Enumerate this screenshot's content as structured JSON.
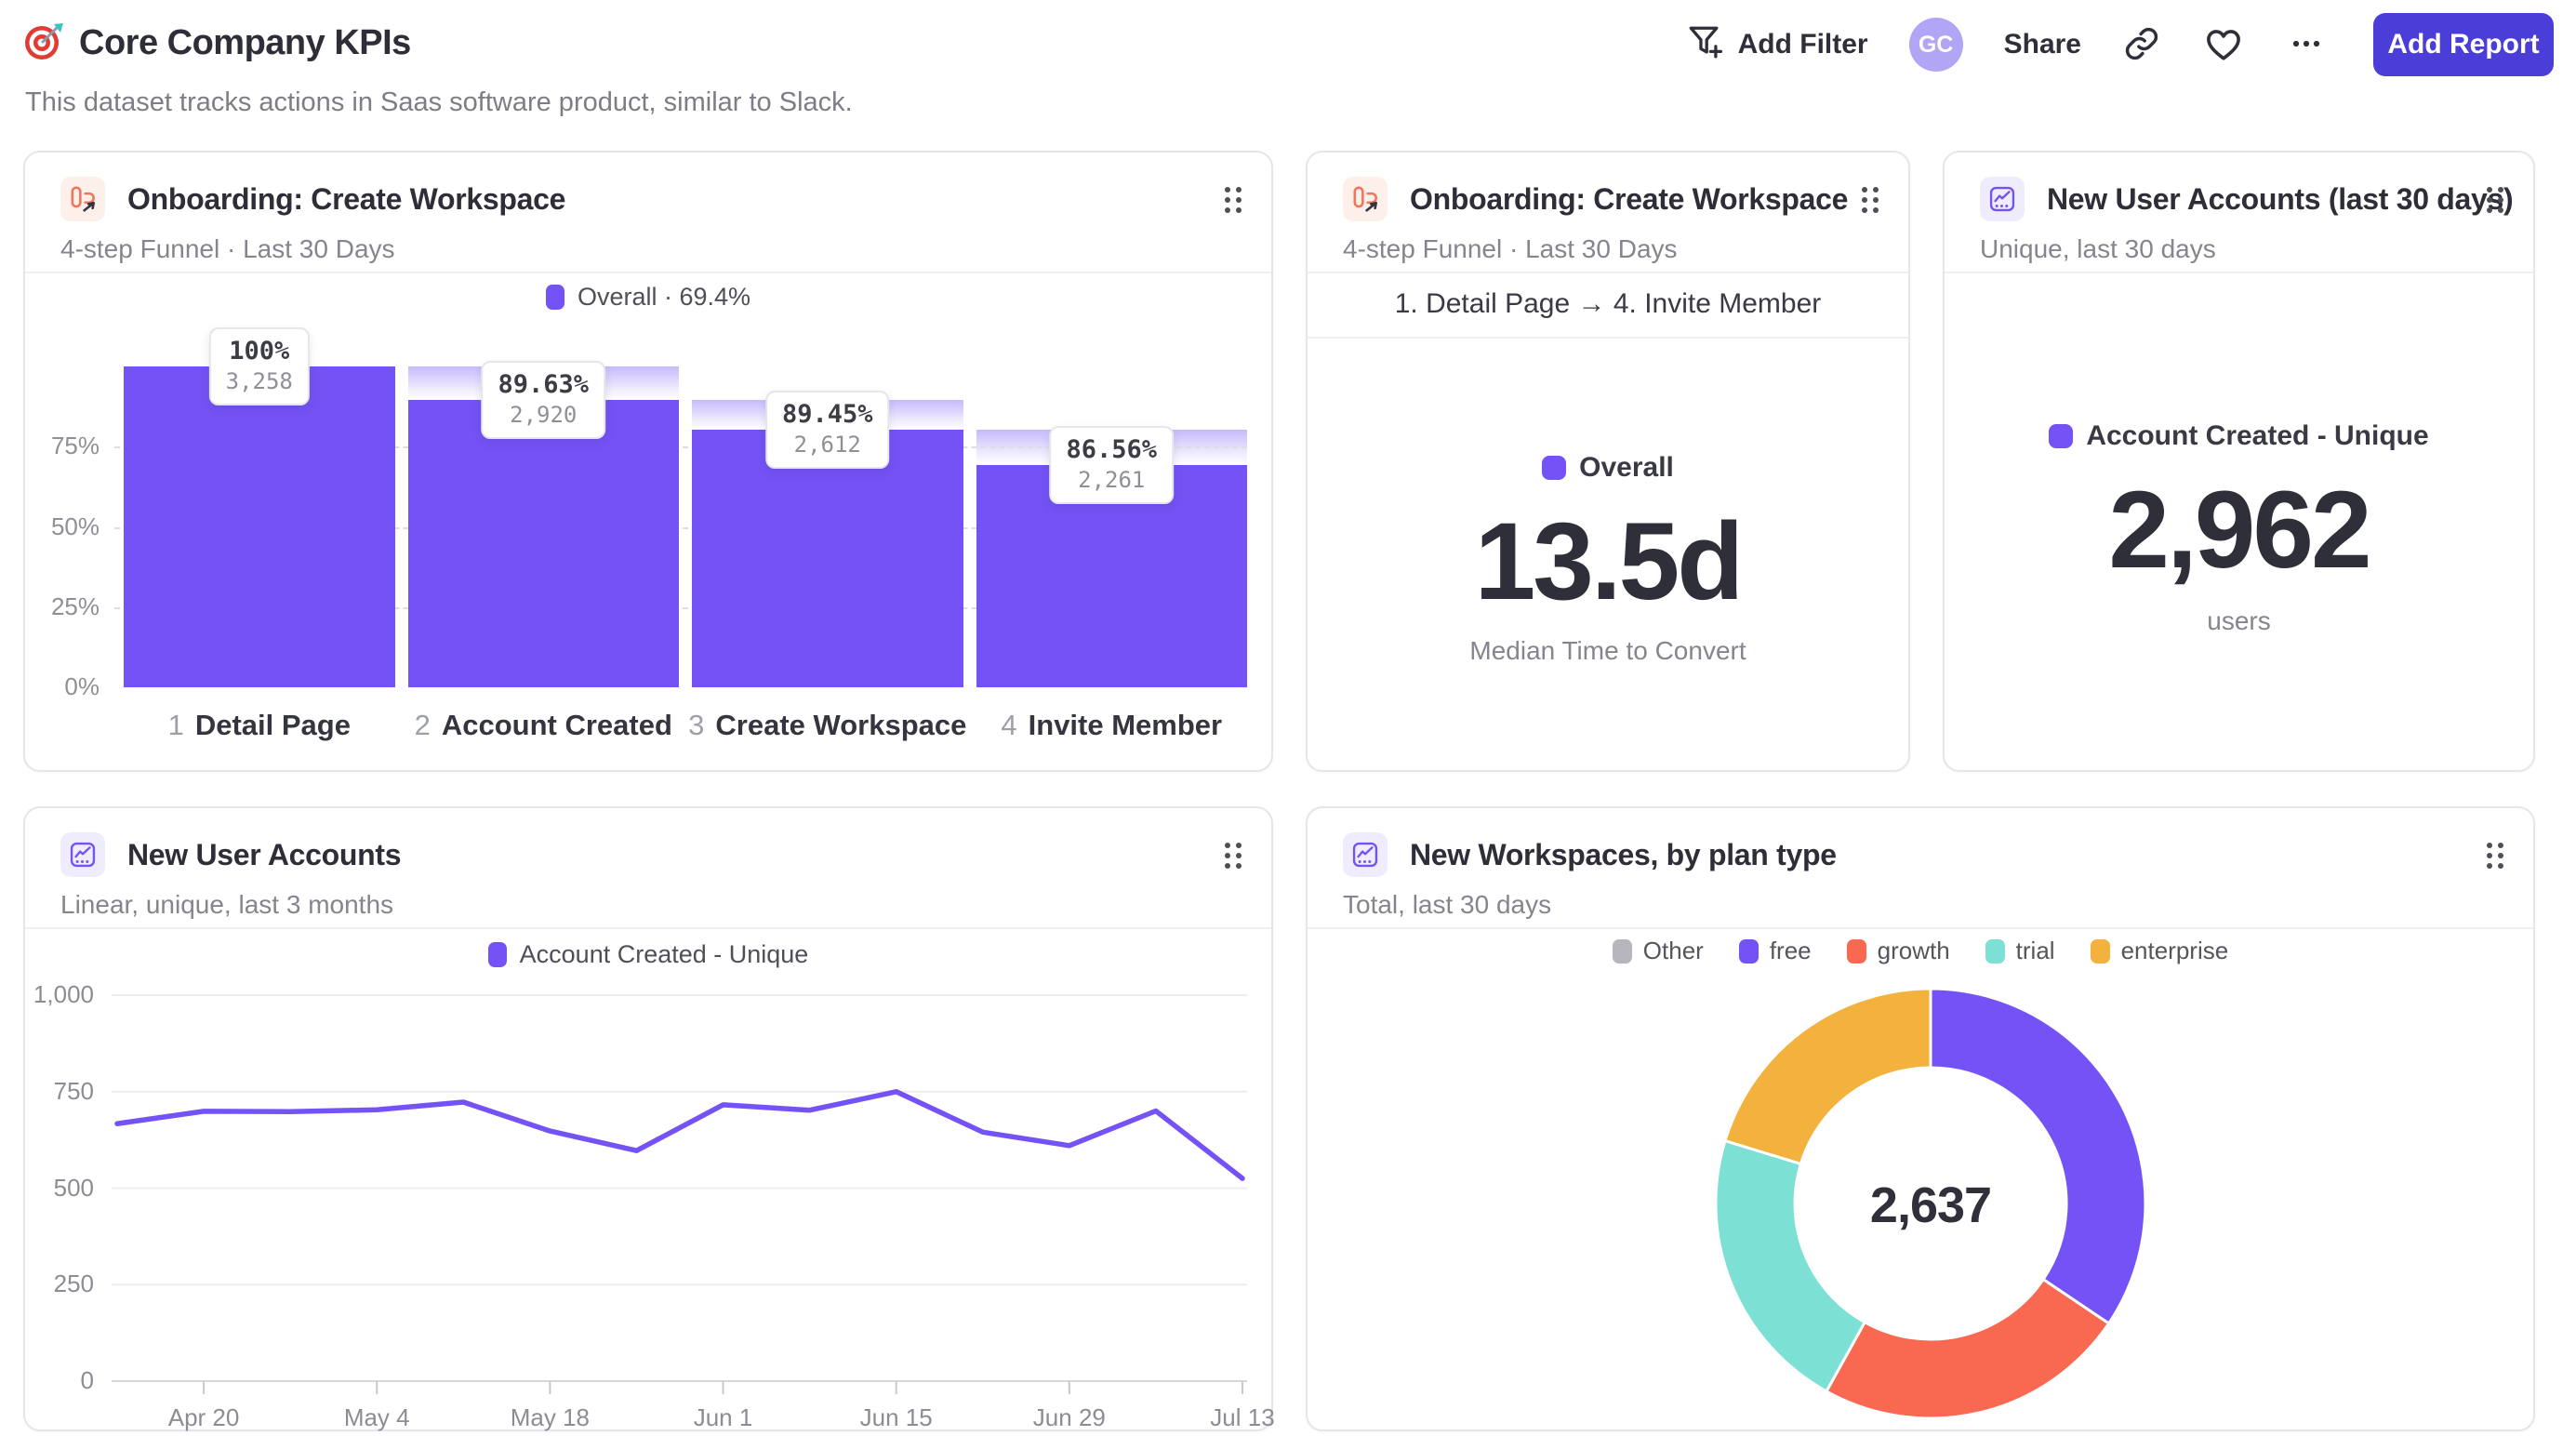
{
  "page": {
    "title": "Core Company KPIs",
    "subtitle": "This dataset tracks actions in Saas software product, similar to Slack."
  },
  "toolbar": {
    "add_filter": "Add Filter",
    "avatar_initials": "GC",
    "share": "Share",
    "add_report": "Add Report"
  },
  "cards": {
    "funnel": {
      "title": "Onboarding: Create Workspace",
      "subtitle": "4-step Funnel · Last 30 Days",
      "legend": "Overall · 69.4%"
    },
    "median_time": {
      "title": "Onboarding: Create Workspace",
      "subtitle": "4-step Funnel · Last 30 Days",
      "range": "1. Detail Page → 4. Invite Member",
      "legend": "Overall",
      "value": "13.5d",
      "caption": "Median Time to Convert"
    },
    "new_accounts": {
      "title": "New User Accounts (last 30 days)",
      "subtitle": "Unique, last 30 days",
      "legend": "Account Created - Unique",
      "value": "2,962",
      "caption": "users"
    },
    "accounts_trend": {
      "title": "New User Accounts",
      "subtitle": "Linear, unique, last 3 months",
      "legend": "Account Created - Unique"
    },
    "workspaces_plan": {
      "title": "New Workspaces, by plan type",
      "subtitle": "Total, last 30 days",
      "center_value": "2,637"
    }
  },
  "colors": {
    "accent": "#7452f5",
    "add_report_button": "#4b3ed8",
    "avatar_bg": "#b1a5f6"
  },
  "chart_data": [
    {
      "id": "onboarding-funnel",
      "type": "bar",
      "title": "Onboarding: Create Workspace",
      "legend": "Overall · 69.4%",
      "overall_conversion_pct": 69.4,
      "bar_color": "#7452f5",
      "yticks": [
        "0%",
        "25%",
        "50%",
        "75%"
      ],
      "steps": [
        {
          "num": "1",
          "label": "Detail Page",
          "conversion_pct": "100%",
          "count": "3,258",
          "height_pct": 100,
          "prev_height_pct": 100
        },
        {
          "num": "2",
          "label": "Account Created",
          "conversion_pct": "89.63%",
          "count": "2,920",
          "height_pct": 89.63,
          "prev_height_pct": 100
        },
        {
          "num": "3",
          "label": "Create Workspace",
          "conversion_pct": "89.45%",
          "count": "2,612",
          "height_pct": 80.17,
          "prev_height_pct": 89.63
        },
        {
          "num": "4",
          "label": "Invite Member",
          "conversion_pct": "86.56%",
          "count": "2,261",
          "height_pct": 69.4,
          "prev_height_pct": 80.17
        }
      ]
    },
    {
      "id": "new-user-accounts-trend",
      "type": "line",
      "title": "New User Accounts",
      "line_color": "#7452f5",
      "ylim": [
        0,
        1000
      ],
      "yticks": [
        0,
        250,
        500,
        750,
        1000
      ],
      "x_tick_labels": [
        "Apr 20",
        "May 4",
        "May 18",
        "Jun 1",
        "Jun 15",
        "Jun 29",
        "Jul 13"
      ],
      "x_tick_indices": [
        1,
        3,
        5,
        7,
        9,
        11,
        13
      ],
      "series": [
        {
          "name": "Account Created - Unique",
          "values": [
            667,
            699,
            698,
            703,
            723,
            648,
            597,
            716,
            702,
            750,
            645,
            610,
            700,
            525
          ]
        }
      ]
    },
    {
      "id": "workspaces-by-plan",
      "type": "pie",
      "title": "New Workspaces, by plan type",
      "center_total": "2,637",
      "segments": [
        {
          "label": "Other",
          "value": 0,
          "color": "#b6b6bc"
        },
        {
          "label": "free",
          "value": 908,
          "color": "#7452f5"
        },
        {
          "label": "growth",
          "value": 623,
          "color": "#f96851"
        },
        {
          "label": "trial",
          "value": 571,
          "color": "#7ce0d4"
        },
        {
          "label": "enterprise",
          "value": 535,
          "color": "#f3b23e"
        }
      ]
    }
  ]
}
